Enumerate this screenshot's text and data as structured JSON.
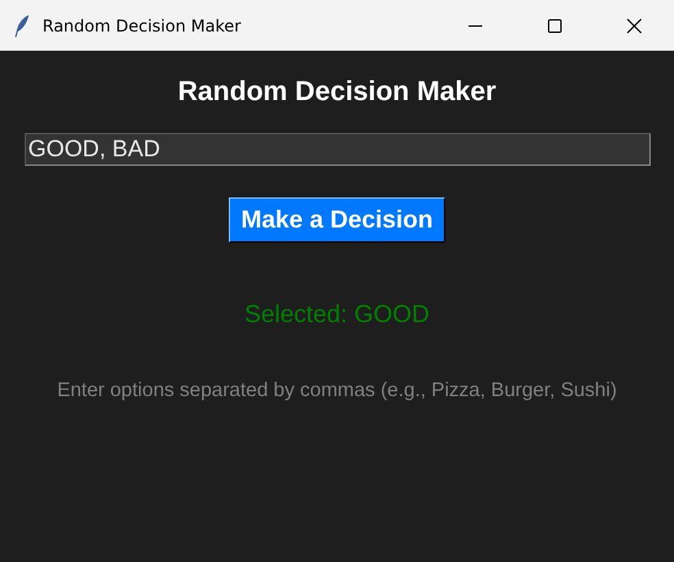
{
  "window": {
    "title": "Random Decision Maker"
  },
  "heading": "Random Decision Maker",
  "options_field": {
    "value": "GOOD, BAD"
  },
  "decide_button": {
    "label": "Make a Decision"
  },
  "result": "Selected: GOOD",
  "hint": "Enter options separated by commas (e.g., Pizza, Burger, Sushi)"
}
